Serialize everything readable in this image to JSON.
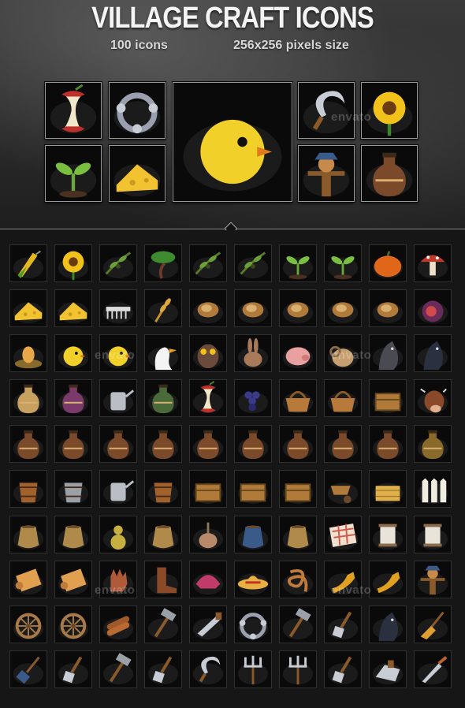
{
  "header": {
    "title": "VILLAGE CRAFT ICONS",
    "count_label": "100 icons",
    "size_label": "256x256  pixels size"
  },
  "watermark": "envato",
  "colors": {
    "background": "#121212",
    "header_bg": "#2e2e2e",
    "title": "#f4f4f4",
    "tile_border": "#303030",
    "feature_border": "#9a9a9a"
  },
  "featured": [
    "apple-core-icon",
    "tambourine-icon",
    "chicken-icon",
    "sickle-icon",
    "sunflower-icon",
    "sprout-icon",
    "cheese-wheel-icon",
    "scarecrow-icon",
    "jug-icon"
  ],
  "icon_rows": [
    [
      "corn-icon",
      "sunflower-icon",
      "olive-branch-icon",
      "bonsai-tree-icon",
      "herb-branch-icon",
      "bamboo-icon",
      "sprout-icon",
      "seedling-icon",
      "pumpkin-icon",
      "mushroom-icon"
    ],
    [
      "cheese-wheel-icon",
      "cheese-wedge-icon",
      "comb-icon",
      "wheat-icon",
      "pistachio-icon",
      "almond-icon",
      "peanut-icon",
      "hazelnut-icon",
      "cacao-pod-icon",
      "fig-icon"
    ],
    [
      "egg-nest-icon",
      "chick-icon",
      "chicken-icon",
      "goose-icon",
      "owl-icon",
      "rabbit-icon",
      "pig-icon",
      "ram-icon",
      "donkey-icon",
      "horse-icon"
    ],
    [
      "amphora-icon",
      "potion-jug-icon",
      "watering-can-icon",
      "green-jar-icon",
      "apple-core-icon",
      "grapes-icon",
      "bread-basket-icon",
      "wicker-basket-icon",
      "wooden-box-icon",
      "cow-icon"
    ],
    [
      "clay-pot-icon",
      "wide-vase-icon",
      "flask-icon",
      "bottle-icon",
      "jug-icon",
      "round-jug-icon",
      "pitcher-icon",
      "decanter-icon",
      "gourd-jug-icon",
      "honey-pot-icon"
    ],
    [
      "wooden-bucket-icon",
      "milk-bucket-icon",
      "milk-can-icon",
      "barrel-icon",
      "treasure-chest-icon",
      "wooden-crate-icon",
      "open-crate-icon",
      "wheelbarrow-icon",
      "hay-bale-icon",
      "fence-icon"
    ],
    [
      "grain-sack-icon",
      "leather-pouch-icon",
      "calabash-icon",
      "backpack-icon",
      "garlic-icon",
      "coin-pouch-icon",
      "seed-bag-icon",
      "tablecloth-icon",
      "thread-spool-icon",
      "spindle-icon"
    ],
    [
      "scroll-icon",
      "rolled-rug-icon",
      "glove-icon",
      "boot-icon",
      "bonnet-icon",
      "straw-hat-icon",
      "rope-icon",
      "tassel-icon",
      "horn-icon",
      "scarecrow-icon"
    ],
    [
      "cart-wheel-icon",
      "wagon-wheel-icon",
      "firewood-icon",
      "hammer-icon",
      "saw-icon",
      "tambourine-icon",
      "mace-icon",
      "trowel-icon",
      "horseshoe-icon",
      "broom-icon"
    ],
    [
      "brush-icon",
      "shovel-icon",
      "axe-icon",
      "spade-icon",
      "sickle-icon",
      "pitchfork-icon",
      "rake-icon",
      "hoe-icon",
      "plane-icon",
      "knife-icon"
    ]
  ]
}
